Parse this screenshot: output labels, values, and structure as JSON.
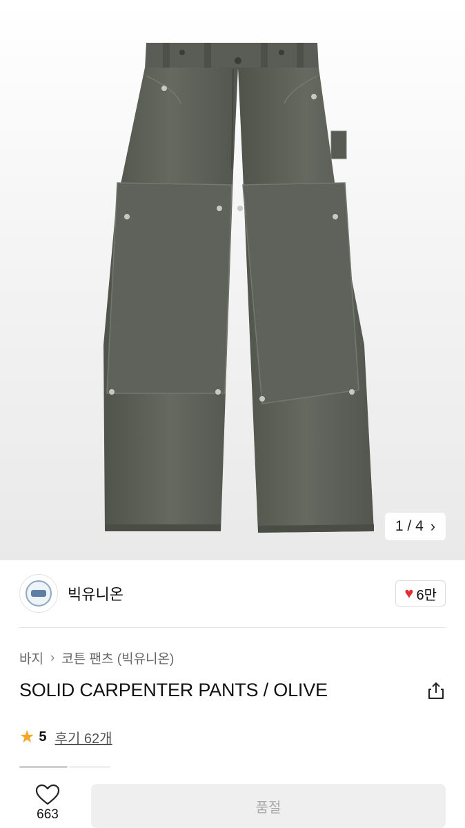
{
  "gallery": {
    "page_current": "1",
    "page_separator": "/",
    "page_total": "4",
    "image_name": "olive-carpenter-pants-photo"
  },
  "seller": {
    "name": "빅유니온",
    "likes": "6만"
  },
  "breadcrumb": {
    "category": "바지",
    "subcategory": "코튼 팬츠 (빅유니온)"
  },
  "product": {
    "title": "SOLID CARPENTER PANTS / OLIVE"
  },
  "rating": {
    "score": "5",
    "reviews": "후기 62개"
  },
  "bottom": {
    "wish_count": "663",
    "buy_label": "품절"
  },
  "colors": {
    "accent_heart": "#e0303a",
    "star": "#f5a623",
    "pants": "#5d605a"
  }
}
